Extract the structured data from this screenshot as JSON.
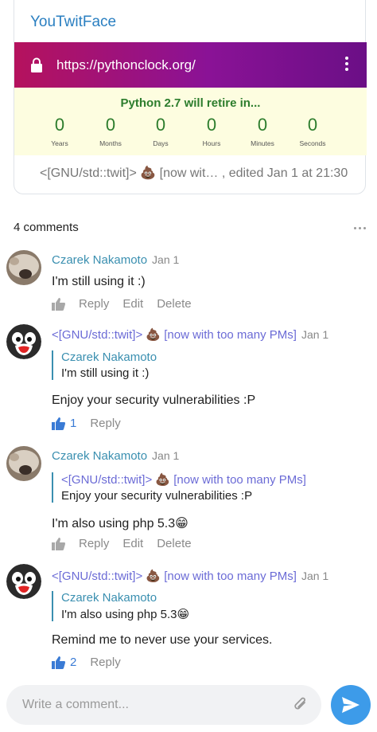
{
  "post": {
    "title": "YouTwitFace",
    "preview": {
      "url": "https://pythonclock.org/",
      "countdown_title": "Python 2.7 will retire in...",
      "units": [
        {
          "value": "0",
          "label": "Years"
        },
        {
          "value": "0",
          "label": "Months"
        },
        {
          "value": "0",
          "label": "Days"
        },
        {
          "value": "0",
          "label": "Hours"
        },
        {
          "value": "0",
          "label": "Minutes"
        },
        {
          "value": "0",
          "label": "Seconds"
        }
      ]
    },
    "meta": "<[GNU/std::twit]> 💩 [now wit… , edited  Jan 1 at 21:30"
  },
  "comments_header": "4 comments",
  "comments": [
    {
      "author": "Czarek Nakamoto",
      "date": "Jan 1",
      "body": "I'm still using it :)",
      "actions": {
        "reply": "Reply",
        "edit": "Edit",
        "delete": "Delete"
      }
    },
    {
      "author": "<[GNU/std::twit]> 💩 [now with too many PMs]",
      "date": "Jan 1",
      "quote_author": "Czarek Nakamoto",
      "quote_text": "I'm still using it :)",
      "body": "Enjoy your security vulnerabilities :P",
      "likes": "1",
      "actions": {
        "reply": "Reply"
      }
    },
    {
      "author": "Czarek Nakamoto",
      "date": "Jan 1",
      "quote_author": "<[GNU/std::twit]> 💩 [now with too many PMs]",
      "quote_text": "Enjoy your security vulnerabilities :P",
      "body": "I'm also using php 5.3😁",
      "actions": {
        "reply": "Reply",
        "edit": "Edit",
        "delete": "Delete"
      }
    },
    {
      "author": "<[GNU/std::twit]> 💩 [now with too many PMs]",
      "date": "Jan 1",
      "quote_author": "Czarek Nakamoto",
      "quote_text": "I'm also using php 5.3😁",
      "body": "Remind me to never use your services.",
      "likes": "2",
      "actions": {
        "reply": "Reply"
      }
    }
  ],
  "input": {
    "placeholder": "Write a comment..."
  },
  "icons": {
    "lock": "lock-icon",
    "menu": "kebab-menu-icon",
    "like": "thumbs-up-icon",
    "attach": "paperclip-icon",
    "send": "send-icon",
    "more": "more-dots-icon"
  },
  "colors": {
    "accent": "#3d9be9",
    "link_blue": "#3a8fb0",
    "purple_name": "#6b6bd6",
    "clock_green": "#2d7d2d"
  }
}
